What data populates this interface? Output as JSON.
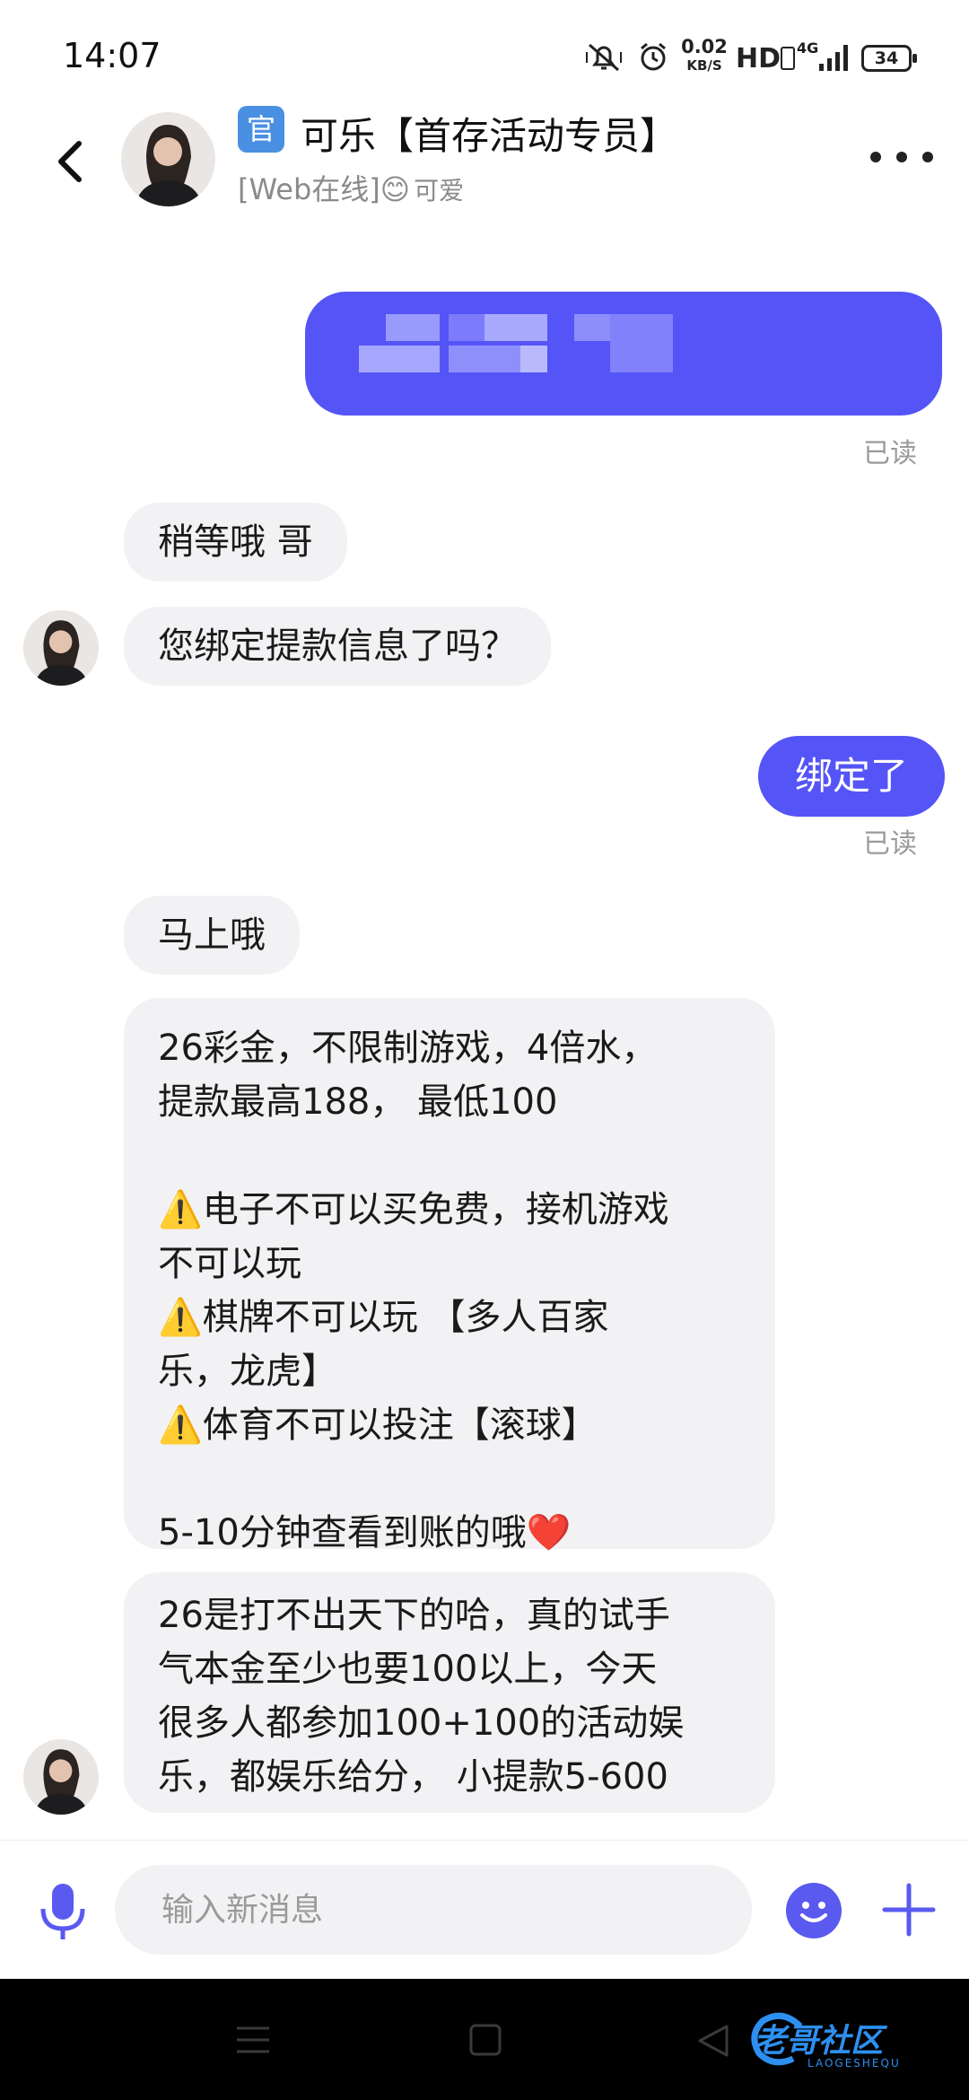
{
  "status_bar": {
    "time": "14:07",
    "net_speed_value": "0.02",
    "net_speed_unit": "KB/S",
    "hd_label": "HD",
    "network_type": "4G",
    "battery": "34"
  },
  "header": {
    "official_badge": "官",
    "contact_name": "可乐【首存活动专员】",
    "online_status": "[Web在线]😊",
    "status_tag": "可爱"
  },
  "messages": [
    {
      "id": 1,
      "direction": "out",
      "text": "",
      "blurred": true,
      "read": "已读"
    },
    {
      "id": 2,
      "direction": "in",
      "text": "稍等哦 哥"
    },
    {
      "id": 3,
      "direction": "in",
      "text": "您绑定提款信息了吗？"
    },
    {
      "id": 4,
      "direction": "out",
      "text": "绑定了",
      "read": "已读"
    },
    {
      "id": 5,
      "direction": "in",
      "text": "马上哦"
    },
    {
      "id": 6,
      "direction": "in",
      "text": "26彩金，不限制游戏，4倍水，\n提款最高188， 最低100\n\n⚠️电子不可以买免费，接机游戏\n不可以玩\n⚠️棋牌不可以玩 【多人百家\n乐，龙虎】\n⚠️体育不可以投注【滚球】\n\n5-10分钟查看到账的哦❤️"
    },
    {
      "id": 7,
      "direction": "in",
      "text": "26是打不出天下的哈，真的试手\n气本金至少也要100以上，今天\n很多人都参加100+100的活动娱\n乐，都娱乐给分， 小提款5-600"
    }
  ],
  "composer": {
    "placeholder": "输入新消息"
  },
  "watermark": {
    "text": "老哥社区",
    "sub": "LAOGESHEQU"
  },
  "colors": {
    "accent": "#5554f6",
    "incoming_bubble": "#f2f2f4",
    "badge_blue": "#4a90e2"
  }
}
